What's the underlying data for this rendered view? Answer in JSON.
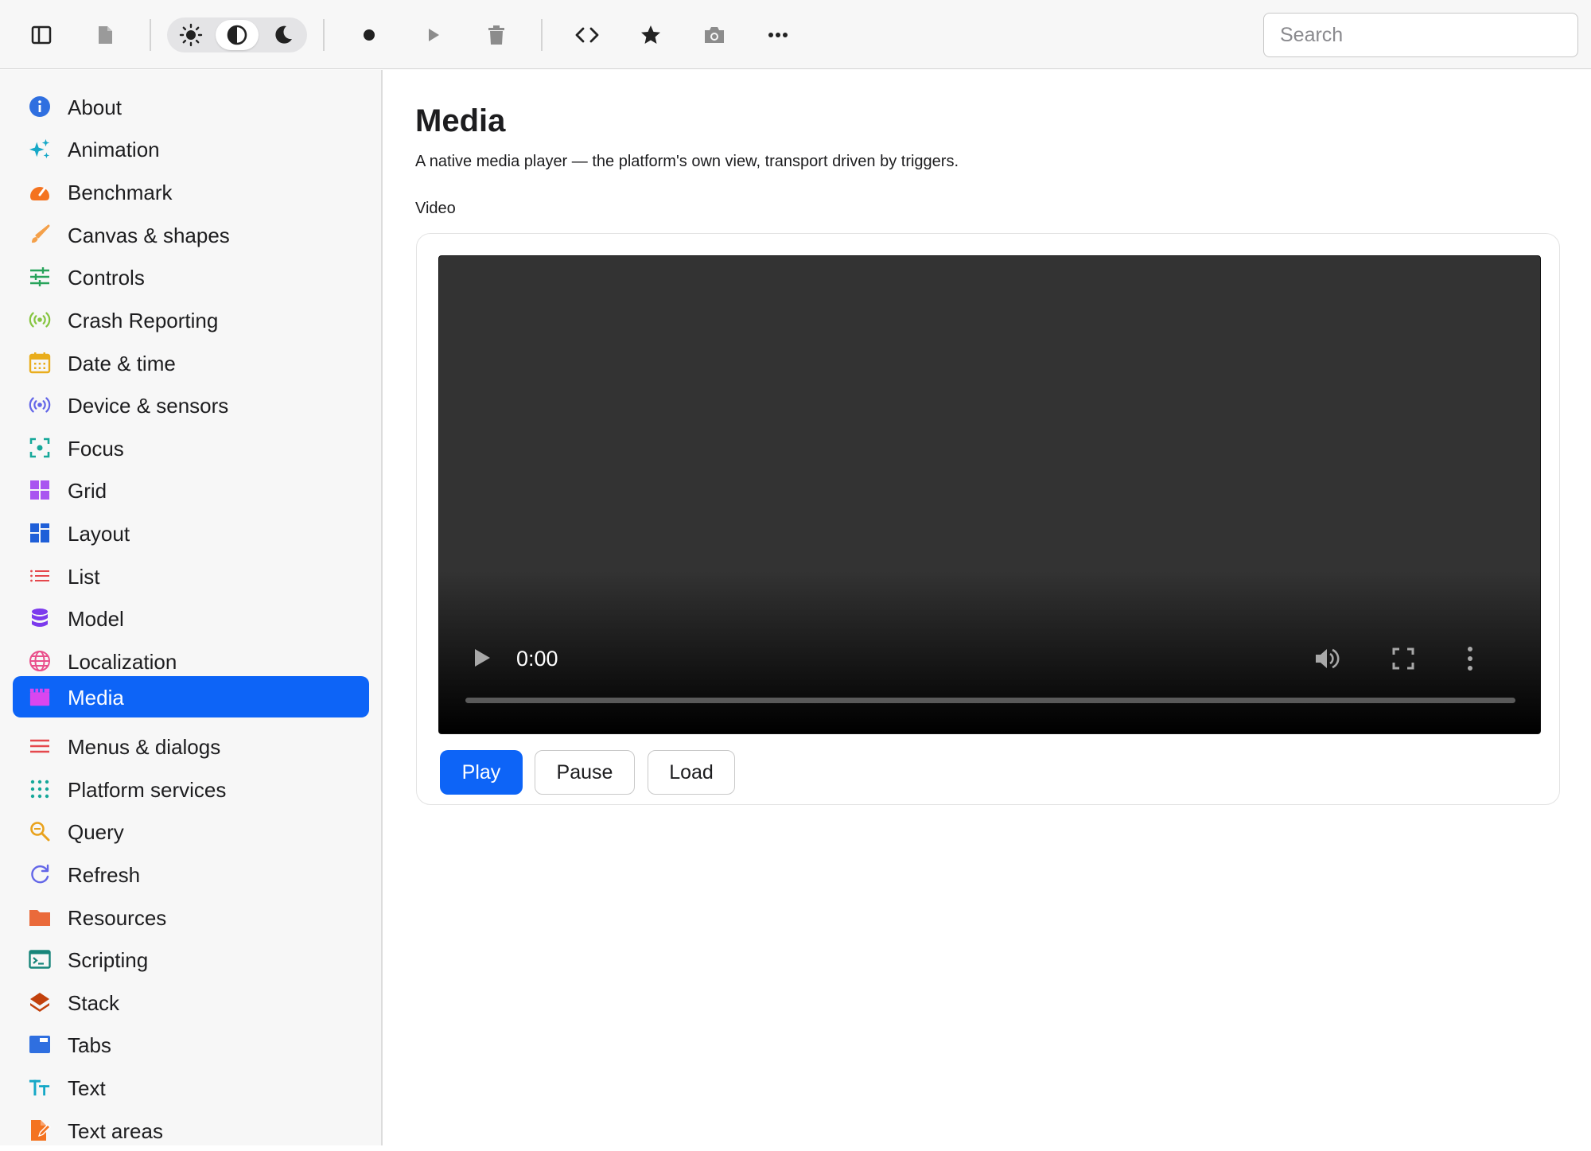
{
  "toolbar": {
    "icons": {
      "sidebar_toggle": "sidebar-icon",
      "document": "document-icon",
      "theme_light": "sun-icon",
      "theme_auto": "contrast-icon",
      "theme_dark": "moon-icon",
      "record": "record-icon",
      "run": "play-icon",
      "delete": "trash-icon",
      "code": "code-icon",
      "favorite": "star-icon",
      "screenshot": "camera-icon",
      "more": "ellipsis-icon"
    },
    "theme_selected": "auto",
    "search": {
      "placeholder": "Search",
      "value": ""
    }
  },
  "sidebar": {
    "items": [
      {
        "label": "About",
        "icon": "info-icon",
        "color": "#2f6fe0"
      },
      {
        "label": "Animation",
        "icon": "sparkles-icon",
        "color": "#16a8c7"
      },
      {
        "label": "Benchmark",
        "icon": "gauge-icon",
        "color": "#f47320"
      },
      {
        "label": "Canvas & shapes",
        "icon": "paintbrush-icon",
        "color": "#f4a04a"
      },
      {
        "label": "Controls",
        "icon": "sliders-icon",
        "color": "#27a35a"
      },
      {
        "label": "Crash Reporting",
        "icon": "broadcast-icon",
        "color": "#86c540"
      },
      {
        "label": "Date & time",
        "icon": "calendar-icon",
        "color": "#e9ad1c"
      },
      {
        "label": "Device & sensors",
        "icon": "sensor-icon",
        "color": "#6366e8"
      },
      {
        "label": "Focus",
        "icon": "focus-icon",
        "color": "#16a89a"
      },
      {
        "label": "Grid",
        "icon": "grid-icon",
        "color": "#a955f0"
      },
      {
        "label": "Layout",
        "icon": "layout-icon",
        "color": "#1f5fd8"
      },
      {
        "label": "List",
        "icon": "list-icon",
        "color": "#e5484d"
      },
      {
        "label": "Model",
        "icon": "database-icon",
        "color": "#7c3aed"
      },
      {
        "label": "Localization",
        "icon": "globe-icon",
        "color": "#e94f8b"
      },
      {
        "label": "Media",
        "icon": "clapperboard-icon",
        "color": "#d946ef",
        "selected": true
      },
      {
        "label": "Menus & dialogs",
        "icon": "menu-icon",
        "color": "#e5484d"
      },
      {
        "label": "Platform services",
        "icon": "dots-grid-icon",
        "color": "#16a89a"
      },
      {
        "label": "Query",
        "icon": "magnifier-icon",
        "color": "#e9a21c"
      },
      {
        "label": "Refresh",
        "icon": "refresh-icon",
        "color": "#6366e8"
      },
      {
        "label": "Resources",
        "icon": "folder-icon",
        "color": "#ea6a3a"
      },
      {
        "label": "Scripting",
        "icon": "terminal-icon",
        "color": "#17857a"
      },
      {
        "label": "Stack",
        "icon": "layers-icon",
        "color": "#c2410c"
      },
      {
        "label": "Tabs",
        "icon": "tabs-icon",
        "color": "#2f6fe0"
      },
      {
        "label": "Text",
        "icon": "text-size-icon",
        "color": "#16a8c7"
      },
      {
        "label": "Text areas",
        "icon": "document-edit-icon",
        "color": "#f47320"
      }
    ]
  },
  "main": {
    "title": "Media",
    "subtitle": "A native media player — the platform's own view, transport driven by triggers.",
    "section_label": "Video",
    "player": {
      "time": "0:00",
      "progress": 0,
      "icons": [
        "play-icon",
        "volume-icon",
        "fullscreen-icon",
        "more-vertical-icon"
      ]
    },
    "buttons": {
      "play": "Play",
      "pause": "Pause",
      "load": "Load"
    }
  },
  "colors": {
    "accent": "#0d64f7",
    "sidebar_bg": "#f7f7f7",
    "video_bg": "#333333"
  }
}
